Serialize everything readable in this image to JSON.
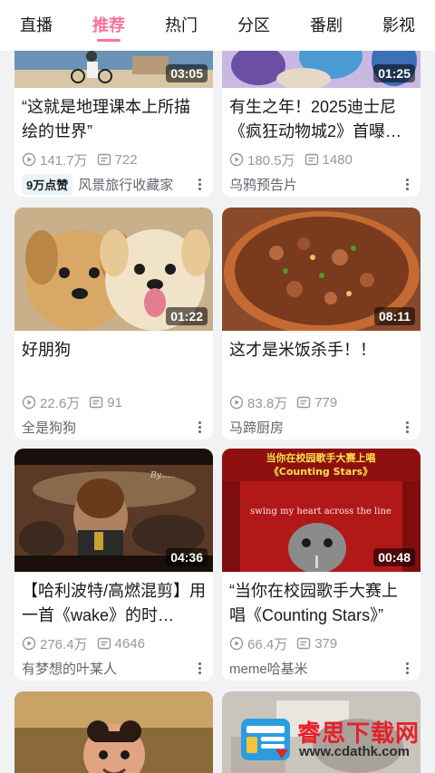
{
  "tabs": [
    {
      "label": "直播"
    },
    {
      "label": "推荐"
    },
    {
      "label": "热门"
    },
    {
      "label": "分区"
    },
    {
      "label": "番剧"
    },
    {
      "label": "影视"
    }
  ],
  "active_tab": "推荐",
  "cards": [
    {
      "title": "“这就是地理课本上所描绘的世界”",
      "duration": "03:05",
      "views": "141.7万",
      "danmaku": "722",
      "badge": "9万点赞",
      "uploader": "风景旅行收藏家"
    },
    {
      "title": "有生之年！2025迪士尼《疯狂动物城2》首曝…",
      "duration": "01:25",
      "views": "180.5万",
      "danmaku": "1480",
      "badge": "",
      "uploader": "乌鸦预告片"
    },
    {
      "title": "好朋狗",
      "duration": "01:22",
      "views": "22.6万",
      "danmaku": "91",
      "badge": "",
      "uploader": "全是狗狗"
    },
    {
      "title": "这才是米饭杀手！！",
      "duration": "08:11",
      "views": "83.8万",
      "danmaku": "779",
      "badge": "",
      "uploader": "马蹄厨房"
    },
    {
      "title": "【哈利波特/高燃混剪】用一首《wake》的时…",
      "duration": "04:36",
      "views": "276.4万",
      "danmaku": "4646",
      "badge": "",
      "uploader": "有梦想的叶某人"
    },
    {
      "title": "“当你在校园歌手大赛上唱《Counting Stars》”",
      "duration": "00:48",
      "views": "66.4万",
      "danmaku": "379",
      "badge": "",
      "uploader": "meme哈基米"
    }
  ],
  "thumb_text": {
    "card5_corner": "By......",
    "card6_line1": "当你在校园歌手大赛上唱",
    "card6_line2": "《Counting Stars》",
    "card6_sub": "swing my heart across the line"
  },
  "watermark": {
    "name": "睿思下载网",
    "url": "www.cdathk.com"
  },
  "colors": {
    "accent": "#fb7299",
    "background": "#f1f2f4",
    "meta": "#9499a0"
  }
}
